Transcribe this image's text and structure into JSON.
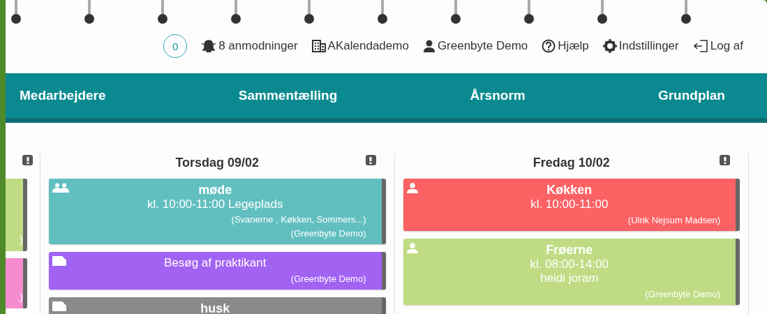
{
  "header": {
    "counter": "0",
    "links": [
      {
        "kind": "bell",
        "label": "8 anmodninger"
      },
      {
        "kind": "building",
        "label": "AKalendademo"
      },
      {
        "kind": "person",
        "label": "Greenbyte Demo"
      },
      {
        "kind": "help",
        "label": "Hjælp"
      },
      {
        "kind": "gear",
        "label": "Indstillinger"
      },
      {
        "kind": "logout",
        "label": "Log af"
      }
    ]
  },
  "nav": [
    "Medarbejdere",
    "Sammentælling",
    "Årsnorm",
    "Grundplan"
  ],
  "partial_column": {
    "events": [
      {
        "color": "#bfdc84",
        "lines": [
          ")"
        ]
      },
      {
        "color": "#f78bd0",
        "lines": [
          ".)"
        ]
      }
    ]
  },
  "days": [
    {
      "title": "Torsdag 09/02",
      "events": [
        {
          "kind": "group",
          "color": "#62bfc0",
          "title": "møde",
          "time": "kl. 10:00-11:00 Legeplads",
          "note": "(Svanerne , Køkken, Sommers...)",
          "owner": "(Greenbyte Demo)"
        },
        {
          "kind": "note",
          "color": "#a262f2",
          "time": "Besøg af praktikant",
          "owner": "(Greenbyte Demo)"
        },
        {
          "kind": "note",
          "color": "#8a8a8a",
          "title": "husk"
        }
      ]
    },
    {
      "title": "Fredag 10/02",
      "events": [
        {
          "kind": "person",
          "color": "#fc6163",
          "title": "Køkken",
          "time": "kl. 10:00-11:00",
          "owner": "(Ulrik Nejsum Madsen)"
        },
        {
          "kind": "person",
          "color": "#bfdc84",
          "title": "Frøerne",
          "time": "kl. 08:00-14:00",
          "note": "heidi joram",
          "owner": "(Greenbyte Demo)"
        }
      ]
    }
  ]
}
